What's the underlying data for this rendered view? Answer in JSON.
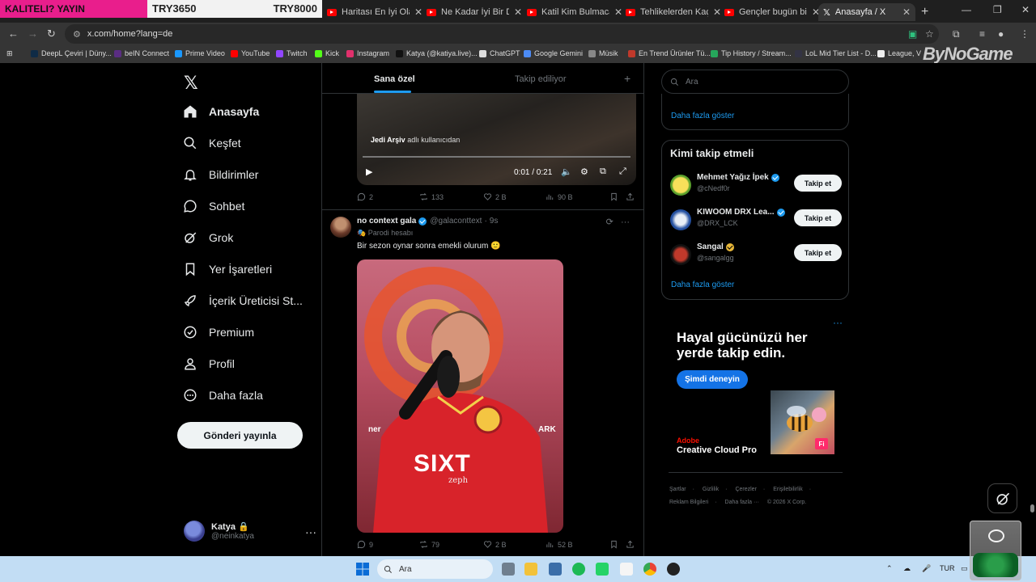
{
  "overlay": {
    "left": "KALITELI? YAYIN",
    "mid": "TRY3650",
    "right": "TRY8000"
  },
  "browser": {
    "tabs": [
      {
        "title": "Haritası En İyi Olan B",
        "icon": "youtube-icon"
      },
      {
        "title": "Ne Kadar İyi Bir Dede",
        "icon": "youtube-icon"
      },
      {
        "title": "Katil Kim Bulmacaları",
        "icon": "youtube-icon"
      },
      {
        "title": "Tehlikelerden Kaçıp K",
        "icon": "youtube-icon"
      },
      {
        "title": "Gençler bugün bir ba",
        "icon": "youtube-icon"
      },
      {
        "title": "Anasayfa / X",
        "icon": "x-logo-icon"
      }
    ],
    "url": "x.com/home?lang=de",
    "bookmarks": [
      "DeepL Çeviri | Düny...",
      "beIN Connect",
      "Prime Video",
      "YouTube",
      "Twitch",
      "Kick",
      "Instagram",
      "Katya (@katiya.live)...",
      "ChatGPT",
      "Google Gemini",
      "Müsik",
      "En Trend Ürünler Tü...",
      "Tip History / Stream...",
      "LoL Mid Tier List - D...",
      "League, V"
    ],
    "watermark": "ByNoGame"
  },
  "nav": {
    "items": [
      {
        "label": "Anasayfa",
        "icon": "home-icon"
      },
      {
        "label": "Keşfet",
        "icon": "search-icon"
      },
      {
        "label": "Bildirimler",
        "icon": "bell-icon"
      },
      {
        "label": "Sohbet",
        "icon": "chat-icon"
      },
      {
        "label": "Grok",
        "icon": "grok-icon"
      },
      {
        "label": "Yer İşaretleri",
        "icon": "bookmark-icon"
      },
      {
        "label": "İçerik Üreticisi St...",
        "icon": "rocket-icon"
      },
      {
        "label": "Premium",
        "icon": "premium-icon"
      },
      {
        "label": "Profil",
        "icon": "person-icon"
      },
      {
        "label": "Daha fazla",
        "icon": "more-circle-icon"
      }
    ],
    "post_button": "Gönderi yayınla",
    "account": {
      "name": "Katya",
      "handle": "@neinkatya"
    }
  },
  "feed": {
    "tabs": {
      "active": "Sana özel",
      "inactive": "Takip ediliyor"
    },
    "video_tweet": {
      "credit_user": "Jedi Arşiv",
      "credit_suffix": "adlı kullanıcıdan",
      "time": "0:01 / 0:21",
      "replies": "2",
      "reposts": "133",
      "likes": "2 B",
      "views": "90 B"
    },
    "tweet": {
      "name": "no context gala",
      "handle": "@galaconttext",
      "time": "9s",
      "parody": "Parodi hesabı",
      "text": "Bir sezon oynar sonra emekli olurum 🙂",
      "media_texts": {
        "sponsor": "SIXT",
        "overlay": "zeph",
        "brand": "ARK",
        "brand2": "ner"
      },
      "replies": "9",
      "reposts": "79",
      "likes": "2 B",
      "views": "52 B"
    }
  },
  "right": {
    "search_placeholder": "Ara",
    "show_more": "Daha fazla göster",
    "who_to_follow_title": "Kimi takip etmeli",
    "follow_button": "Takip et",
    "suggestions": [
      {
        "name": "Mehmet Yağız İpek",
        "handle": "@cNedf0r",
        "badge": "blue"
      },
      {
        "name": "KIWOOM DRX Lea...",
        "handle": "@DRX_LCK",
        "badge": "blue"
      },
      {
        "name": "Sangal",
        "handle": "@sangalgg",
        "badge": "gold"
      }
    ],
    "ad": {
      "title": "Hayal gücünüzü her yerde takip edin.",
      "button": "Şimdi deneyin",
      "brand": "Adobe",
      "product": "Creative Cloud Pro",
      "img_label": "Fi"
    },
    "footer": [
      "Şartlar",
      "Gizlilik",
      "Çerezler",
      "Erişilebilirlik",
      "Reklam Bilgileri",
      "Daha fazla ···",
      "© 2026 X Corp."
    ]
  },
  "taskbar": {
    "search": "Ara",
    "lang": "TUR"
  },
  "colors": {
    "accent": "#1d9bf0",
    "bg": "#000000",
    "taskbar": "#c2ddf4"
  }
}
